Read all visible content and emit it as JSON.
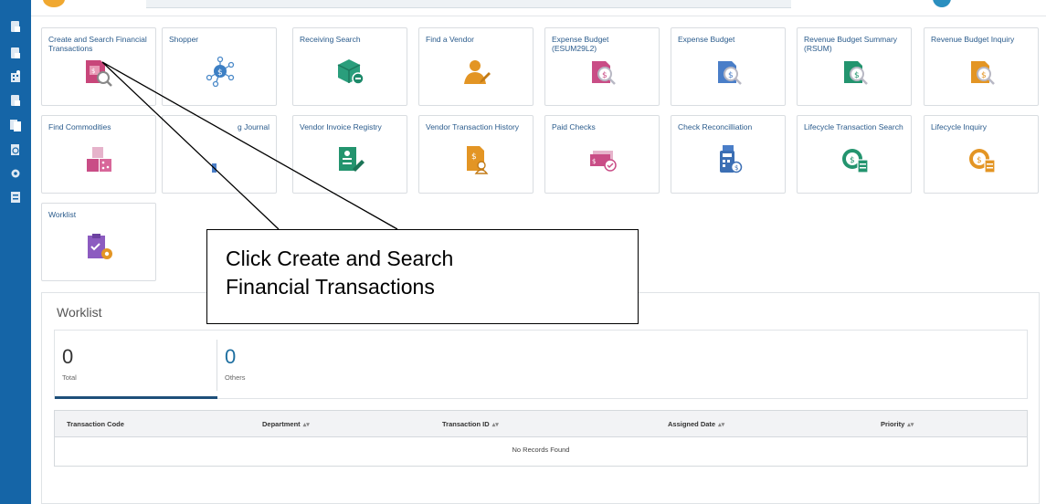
{
  "sidebar": {
    "icons": [
      "document-icon",
      "document-icon",
      "ledger-icon",
      "document-icon",
      "documents-icon",
      "search-document-icon",
      "settings-group-icon",
      "form-icon"
    ]
  },
  "tiles": [
    {
      "label": "Create and Search Financial Transactions",
      "icon": "financial-document-search-icon"
    },
    {
      "label": "Shopper",
      "icon": "network-dollar-icon"
    },
    {
      "label": "Receiving Search",
      "icon": "package-search-icon"
    },
    {
      "label": "Find a Vendor",
      "icon": "vendor-person-icon"
    },
    {
      "label": "Expense Budget (ESUM29L2)",
      "icon": "budget-search-icon"
    },
    {
      "label": "Expense Budget",
      "icon": "budget-search-icon"
    },
    {
      "label": "Revenue Budget Summary (RSUM)",
      "icon": "budget-search-icon"
    },
    {
      "label": "Revenue Budget Inquiry",
      "icon": "budget-search-icon"
    },
    {
      "label": "Find Commodities",
      "icon": "commodity-boxes-icon"
    },
    {
      "label": "g Journal",
      "icon": "journal-icon"
    },
    {
      "label": "Vendor Invoice Registry",
      "icon": "invoice-sign-icon"
    },
    {
      "label": "Vendor Transaction History",
      "icon": "vendor-history-icon"
    },
    {
      "label": "Paid Checks",
      "icon": "check-approved-icon"
    },
    {
      "label": "Check Reconcilliation",
      "icon": "calculator-icon"
    },
    {
      "label": "Lifecycle Transaction Search",
      "icon": "lifecycle-coin-icon"
    },
    {
      "label": "Lifecycle Inquiry",
      "icon": "lifecycle-coin-icon"
    },
    {
      "label": "Worklist",
      "icon": "clipboard-gear-icon"
    }
  ],
  "callout": {
    "line1": "Click Create and Search",
    "line2": "Financial Transactions"
  },
  "worklist": {
    "title": "Worklist",
    "total_count": "0",
    "total_label": "Total",
    "others_count": "0",
    "others_label": "Others",
    "columns": [
      "Transaction Code",
      "Department",
      "Transaction ID",
      "Assigned Date",
      "Priority"
    ],
    "empty_message": "No Records Found"
  },
  "colors": {
    "sidebar": "#1565a7",
    "tile_label": "#2a5b8c",
    "others_count": "#1e6fa0",
    "underline": "#1e4f7a"
  }
}
